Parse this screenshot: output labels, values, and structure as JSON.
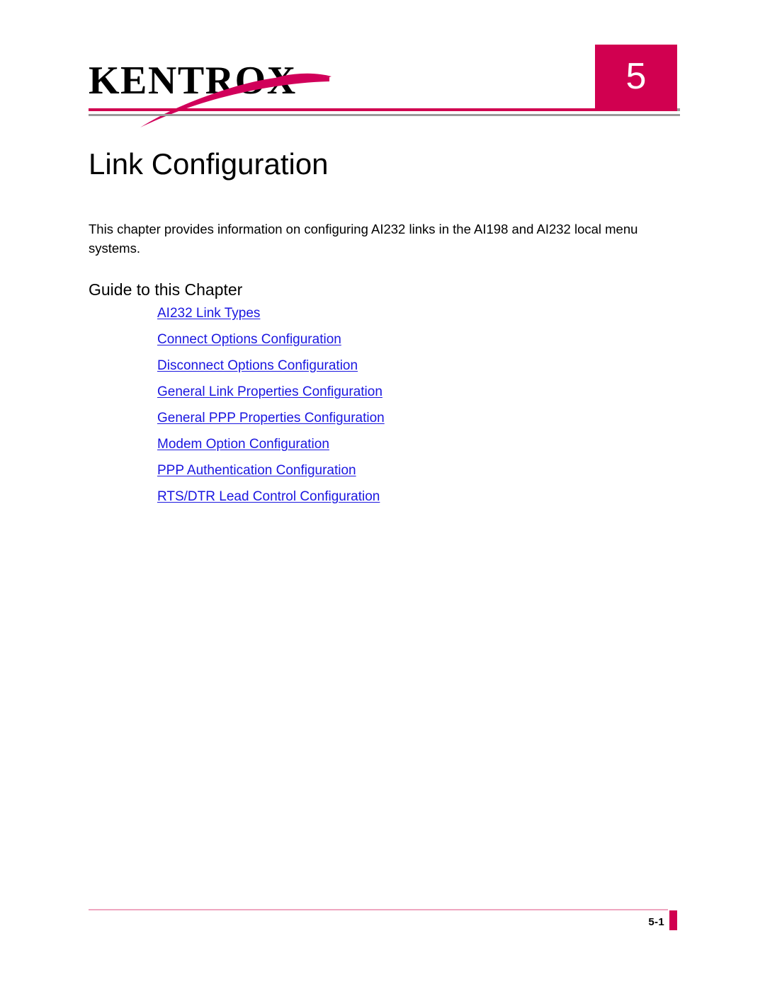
{
  "header": {
    "logo_text": "KENTROX",
    "logo_icon": "kentrox-swoosh-icon",
    "chapter_number": "5",
    "accent_color": "#D10050",
    "rule_gray_color": "#9a9a9a"
  },
  "document": {
    "title": "Link Configuration",
    "intro": "This chapter provides information on configuring AI232 links in the AI198 and AI232 local menu systems.",
    "section_heading": "Guide to this Chapter",
    "link_color": "#1a16e0"
  },
  "toc": {
    "items": [
      {
        "label": "AI232 Link Types"
      },
      {
        "label": "Connect Options Configuration"
      },
      {
        "label": "Disconnect Options Configuration"
      },
      {
        "label": "General Link Properties Configuration"
      },
      {
        "label": "General PPP Properties Configuration"
      },
      {
        "label": "Modem Option Configuration"
      },
      {
        "label": "PPP Authentication Configuration"
      },
      {
        "label": "RTS/DTR Lead Control Configuration"
      }
    ]
  },
  "footer": {
    "page_number": "5-1",
    "tab_color": "#D10050",
    "rule_color": "#efa6c0"
  }
}
